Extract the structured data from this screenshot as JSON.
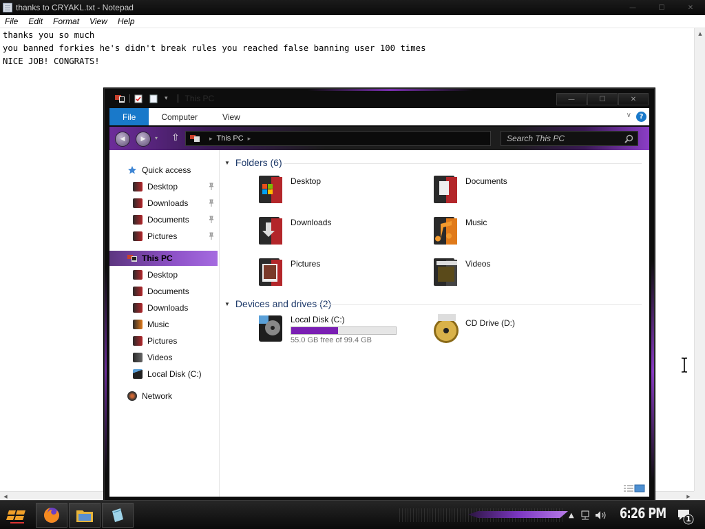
{
  "notepad": {
    "title": "thanks to CRYAKL.txt - Notepad",
    "caption": {
      "minimize": "—",
      "maximize": "☐",
      "close": "✕"
    },
    "menu": [
      "File",
      "Edit",
      "Format",
      "View",
      "Help"
    ],
    "lines": [
      "thanks you so much",
      "you banned forkies he's didn't break rules you reached false banning user 100 times",
      "NICE JOB! CONGRATS!"
    ]
  },
  "explorer": {
    "title": "This PC",
    "caption": {
      "minimize": "—",
      "maximize": "☐",
      "close": "✕"
    },
    "ribbon_tabs": [
      "File",
      "Computer",
      "View"
    ],
    "address": {
      "crumb": "This PC"
    },
    "search": {
      "placeholder": "Search This PC"
    },
    "nav": {
      "quick_access": "Quick access",
      "quick_items": [
        "Desktop",
        "Downloads",
        "Documents",
        "Pictures"
      ],
      "this_pc": "This PC",
      "pc_items": [
        "Desktop",
        "Documents",
        "Downloads",
        "Music",
        "Pictures",
        "Videos",
        "Local Disk (C:)"
      ],
      "network": "Network"
    },
    "folders_header": "Folders (6)",
    "folders": [
      "Desktop",
      "Documents",
      "Downloads",
      "Music",
      "Pictures",
      "Videos"
    ],
    "devices_header": "Devices and drives (2)",
    "drives": [
      {
        "name": "Local Disk (C:)",
        "free_text": "55.0 GB free of 99.4 GB",
        "used_fraction": 0.447
      },
      {
        "name": "CD Drive (D:)"
      }
    ]
  },
  "taskbar": {
    "clock": "6:26 PM",
    "notification_count": "1",
    "pinned": [
      "start-button",
      "firefox",
      "file-explorer",
      "notepad"
    ]
  },
  "icons": [
    "notepad-icon",
    "this-pc-icon",
    "star-icon",
    "folder-icon",
    "pin-icon",
    "network-icon",
    "drive-icon",
    "cd-icon",
    "search-icon",
    "firefox-icon",
    "volume-icon",
    "network-tray-icon",
    "notification-icon"
  ],
  "colors": {
    "accent": "#1979ca",
    "theme_purple": "#8e52c8",
    "drive_bar": "#7a1fb3"
  }
}
